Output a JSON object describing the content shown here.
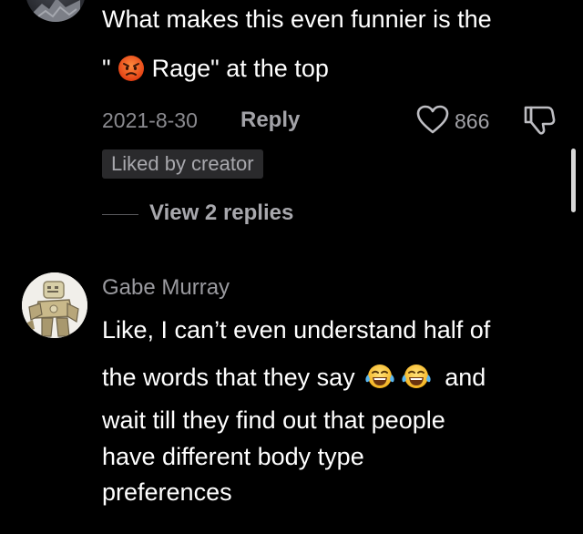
{
  "comment_1": {
    "lines": [
      "What makes this even funnier is the",
      "\"",
      "Rage\" at the top"
    ],
    "date": "2021-8-30",
    "reply_label": "Reply",
    "like_count": "866",
    "liked_by_creator": "Liked by creator",
    "view_replies": "View 2 replies",
    "emoji": "angry-face-emoji"
  },
  "comment_2": {
    "username": "Gabe Murray",
    "lines": [
      "Like, I can’t even understand half of",
      "the words that they say",
      "and",
      "wait till they find out that people",
      "have different body type",
      "preferences"
    ],
    "emoji": "tears-of-joy-emoji"
  },
  "colors": {
    "background": "#000000",
    "text": "#ffffff",
    "muted": "#8a8a8f",
    "badge_bg": "#2a2a2c",
    "angry_emoji": "#e8541e",
    "laugh_emoji": "#f7c530"
  }
}
